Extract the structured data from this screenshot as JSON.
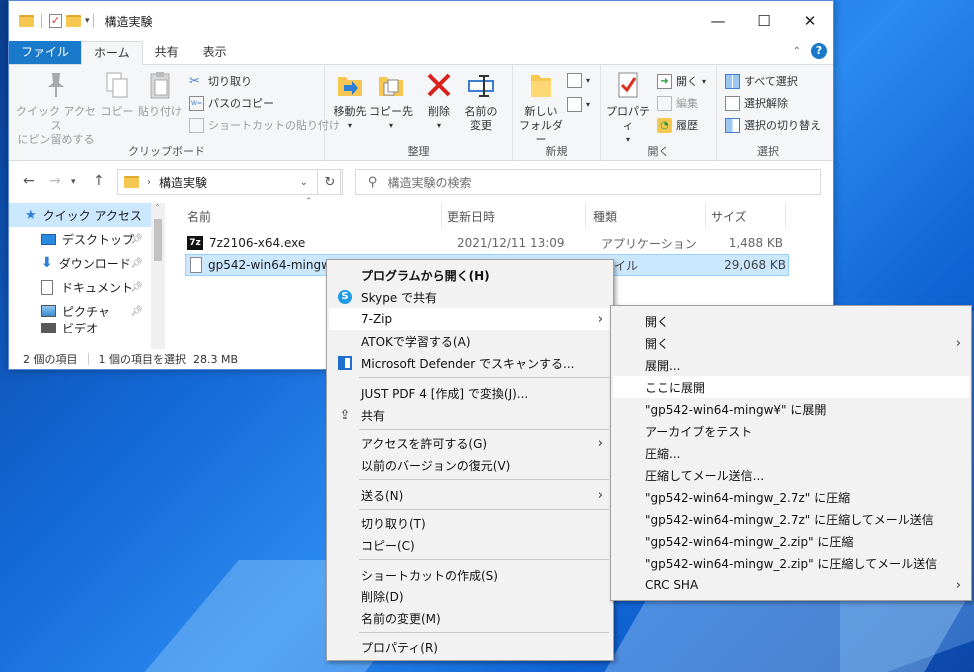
{
  "window": {
    "title": "構造実験",
    "controls": {
      "minimize": "—",
      "maximize": "☐",
      "close": "✕"
    }
  },
  "tabs": [
    "ファイル",
    "ホーム",
    "共有",
    "表示"
  ],
  "ribbon": {
    "clipboard": {
      "label": "クリップボード",
      "pin_quick": "クイック アクセス\nにピン留めする",
      "copy": "コピー",
      "paste": "貼り付け",
      "cut": "切り取り",
      "copy_path": "パスのコピー",
      "paste_shortcut": "ショートカットの貼り付け"
    },
    "organize": {
      "label": "整理",
      "move_to": "移動先",
      "copy_to": "コピー先",
      "delete": "削除",
      "rename": "名前の\n変更"
    },
    "new": {
      "label": "新規",
      "new_folder": "新しい\nフォルダー"
    },
    "open": {
      "label": "開く",
      "properties": "プロパティ",
      "open": "開く",
      "edit": "編集",
      "history": "履歴"
    },
    "select": {
      "label": "選択",
      "select_all": "すべて選択",
      "select_none": "選択解除",
      "invert": "選択の切り替え"
    }
  },
  "address": {
    "path": "構造実験",
    "search_placeholder": "構造実験の検索"
  },
  "nav": {
    "items": [
      "クイック アクセス",
      "デスクトップ",
      "ダウンロード",
      "ドキュメント",
      "ピクチャ",
      "ビデオ"
    ]
  },
  "columns": {
    "name": "名前",
    "modified": "更新日時",
    "type": "種類",
    "size": "サイズ"
  },
  "files": [
    {
      "name": "7z2106-x64.exe",
      "modified": "2021/12/11 13:09",
      "type": "アプリケーション",
      "size": "1,488 KB"
    },
    {
      "name": "gp542-win64-mingw.7z",
      "modified": "",
      "type": "ァイル",
      "size": "29,068 KB"
    }
  ],
  "status": {
    "count": "2 個の項目",
    "selected": "1 個の項目を選択  28.3 MB"
  },
  "context_menu": {
    "open_with": "プログラムから開く(H)",
    "skype": "Skype で共有",
    "sevenzip": "7-Zip",
    "atok": "ATOKで学習する(A)",
    "defender": "Microsoft Defender でスキャンする...",
    "justpdf": "JUST PDF 4 [作成] で変換(J)...",
    "share": "共有",
    "give_access": "アクセスを許可する(G)",
    "restore": "以前のバージョンの復元(V)",
    "send_to": "送る(N)",
    "cut": "切り取り(T)",
    "copy": "コピー(C)",
    "create_shortcut": "ショートカットの作成(S)",
    "delete": "削除(D)",
    "rename": "名前の変更(M)",
    "properties": "プロパティ(R)"
  },
  "submenu": [
    "開く",
    "開く",
    "展開...",
    "ここに展開",
    "\"gp542-win64-mingw¥\" に展開",
    "アーカイブをテスト",
    "圧縮...",
    "圧縮してメール送信...",
    "\"gp542-win64-mingw_2.7z\" に圧縮",
    "\"gp542-win64-mingw_2.7z\" に圧縮してメール送信",
    "\"gp542-win64-mingw_2.zip\" に圧縮",
    "\"gp542-win64-mingw_2.zip\" に圧縮してメール送信",
    "CRC SHA"
  ]
}
